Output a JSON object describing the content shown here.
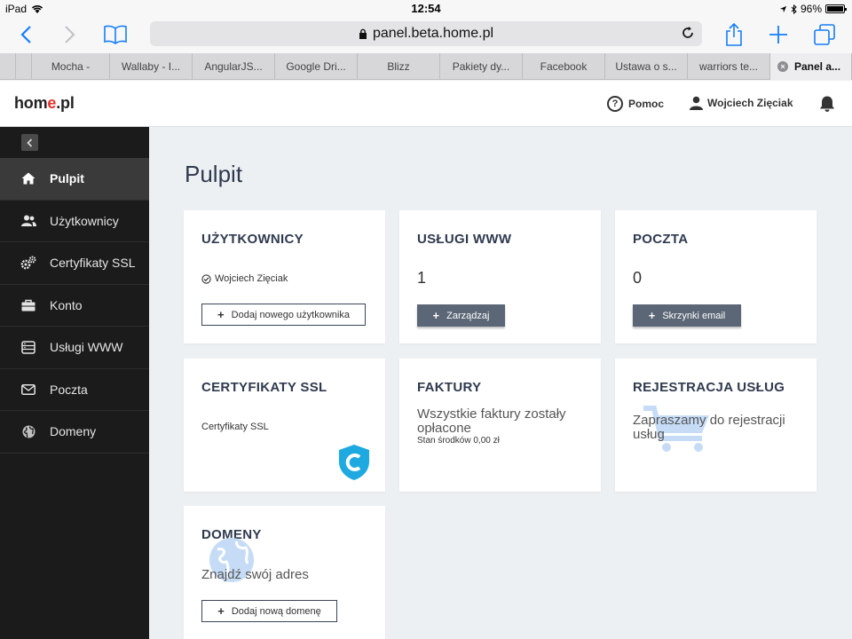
{
  "status_bar": {
    "device": "iPad",
    "time": "12:54",
    "battery": "96%"
  },
  "browser": {
    "url": "panel.beta.home.pl",
    "tabs": [
      {
        "label": ""
      },
      {
        "label": ""
      },
      {
        "label": "Mocha -"
      },
      {
        "label": "Wallaby - I..."
      },
      {
        "label": "AngularJS..."
      },
      {
        "label": "Google Dri..."
      },
      {
        "label": "Blizz"
      },
      {
        "label": "Pakiety dy..."
      },
      {
        "label": "Facebook"
      },
      {
        "label": "Ustawa o s..."
      },
      {
        "label": "warriors te..."
      },
      {
        "label": "Panel a..."
      }
    ]
  },
  "header": {
    "logo_pre": "hom",
    "logo_e": "e",
    "logo_post": ".pl",
    "help_label": "Pomoc",
    "user_name": "Wojciech Zięciak"
  },
  "sidebar": {
    "items": [
      {
        "label": "Pulpit",
        "icon": "home-icon"
      },
      {
        "label": "Użytkownicy",
        "icon": "users-icon"
      },
      {
        "label": "Certyfikaty SSL",
        "icon": "gears-icon"
      },
      {
        "label": "Konto",
        "icon": "briefcase-icon"
      },
      {
        "label": "Usługi WWW",
        "icon": "server-icon"
      },
      {
        "label": "Poczta",
        "icon": "envelope-icon"
      },
      {
        "label": "Domeny",
        "icon": "globe-icon"
      }
    ]
  },
  "main": {
    "title": "Pulpit",
    "cards": {
      "users": {
        "title": "UŻYTKOWNICY",
        "user": "Wojciech Zięciak",
        "button": "Dodaj nowego użytkownika"
      },
      "www": {
        "title": "USŁUGI WWW",
        "count": "1",
        "button": "Zarządzaj"
      },
      "mail": {
        "title": "POCZTA",
        "count": "0",
        "button": "Skrzynki email"
      },
      "ssl": {
        "title": "CERTYFIKATY SSL",
        "text": "Certyfikaty SSL"
      },
      "invoices": {
        "title": "FAKTURY",
        "text": "Wszystkie faktury zostały opłacone",
        "balance": "Stan środków 0,00 zł"
      },
      "registration": {
        "title": "REJESTRACJA USŁUG",
        "text": "Zapraszamy do rejestracji usług"
      },
      "domains": {
        "title": "DOMENY",
        "text": "Znajdź swój adres",
        "button": "Dodaj nową domenę"
      }
    }
  },
  "colors": {
    "accent": "#157efb",
    "brand_red": "#e63329",
    "sidebar_bg": "#1b1b1b",
    "dark_button": "#5b6676",
    "title": "#2f3a4f"
  }
}
